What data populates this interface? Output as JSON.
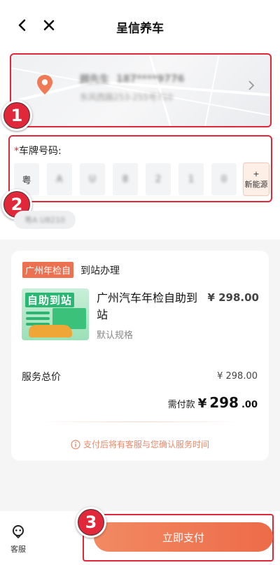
{
  "header": {
    "title": "呈信养车"
  },
  "address": {
    "name": "顾先生",
    "phone": "187****9776",
    "detail": "东风西路253-255号710"
  },
  "badges": [
    "1",
    "2",
    "3"
  ],
  "plate": {
    "label_required": "*",
    "label": "车牌号码:",
    "cells": [
      "粤",
      "A",
      "U",
      "8",
      "2",
      "1",
      "0"
    ],
    "new_energy_plus": "+",
    "new_energy_label": "新能源",
    "saved_chip": "粤A U8210"
  },
  "order": {
    "tag": "广州年检自",
    "tag_desc": "到站办理",
    "thumb_title": "自助到站",
    "product_name": "广州汽车年检自助到站",
    "product_price": "¥ 298.00",
    "spec": "默认规格",
    "total_label": "服务总价",
    "total_price": "¥ 298.00",
    "pay_label": "需付款",
    "pay_currency": "¥",
    "pay_int": "298",
    "pay_dec": ".00",
    "notice": "支付后将有客服与您确认服务时间"
  },
  "bottom": {
    "cs_label": "客服",
    "pay_button": "立即支付"
  },
  "colors": {
    "accent": "#ed6b48",
    "highlight": "#e0283a",
    "tag_bg": "#ec7150"
  }
}
